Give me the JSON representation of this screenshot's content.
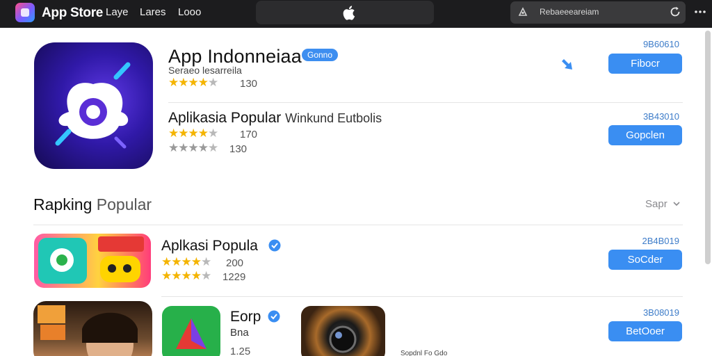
{
  "titlebar": {
    "app_name": "App Store",
    "menu": [
      "Laye",
      "Lares",
      "Looo"
    ],
    "search_text": "Rebaeeeareiam"
  },
  "featured": {
    "title": "App Indonneiaa",
    "badge": "Gonno",
    "subtitle": "Seraeo lesarreila",
    "rating_stars": 4,
    "rating_count": "130",
    "code": "9B60610",
    "button": "Fibocr",
    "second": {
      "title": "Aplikasia Popular",
      "extra": "Winkund Eutbolis",
      "rating1_stars": 4,
      "rating1_count": "170",
      "rating2_stars": 4,
      "rating2_count": "130",
      "code": "3B43010",
      "button": "Gopclen"
    }
  },
  "ranking": {
    "title": "Rapking",
    "title_light": "Popular",
    "sort_label": "Sapr",
    "rows": [
      {
        "title": "Aplkasi Popula",
        "verified": true,
        "rating1_stars": 4,
        "rating1_count": "200",
        "rating2_stars": 4,
        "rating2_count": "1229",
        "code": "2B4B019",
        "button": "SoCder"
      },
      {
        "title": "Eorp",
        "verified": true,
        "subtitle": "Bna",
        "count": "1.25",
        "caption": "Sopdnl Fo Gdo",
        "code": "3B08019",
        "button": "BetOoer"
      }
    ]
  },
  "colors": {
    "accent": "#3a8ef2",
    "star": "#f4b400",
    "titlebar": "#1c1c1e"
  },
  "icons": [
    "app-store-logo",
    "apple-icon",
    "search-icon",
    "refresh-icon",
    "more-icon",
    "share-icon",
    "verified-icon",
    "chevron-down-icon"
  ]
}
